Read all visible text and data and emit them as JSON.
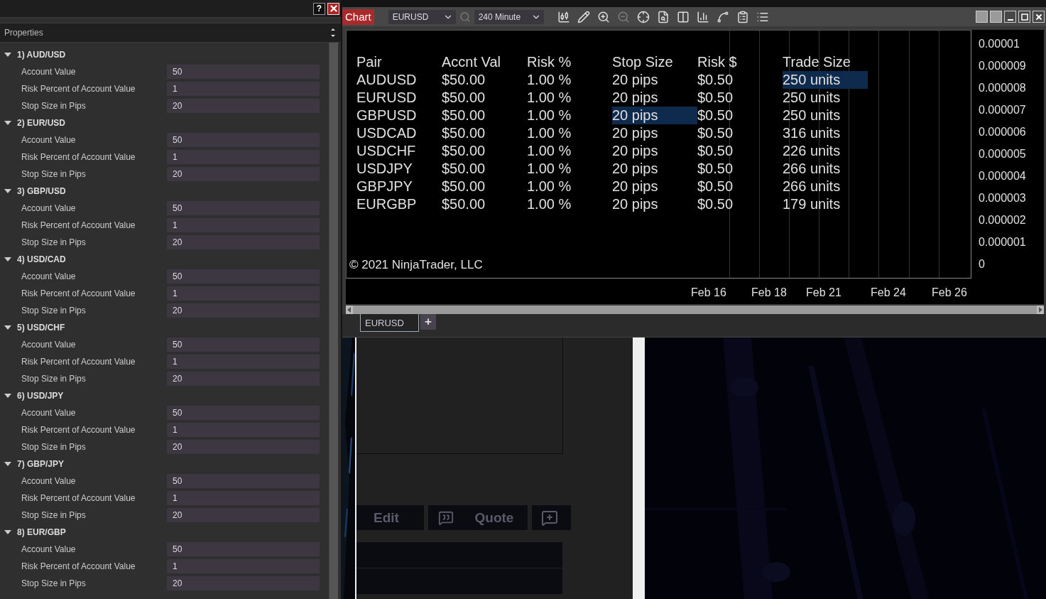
{
  "properties_window": {
    "help": "?",
    "header": "Properties",
    "groups": [
      {
        "title": "1) AUD/USD",
        "expanded": true,
        "rows": [
          {
            "label": "Account Value",
            "value": "50"
          },
          {
            "label": "Risk Percent of Account Value",
            "value": "1"
          },
          {
            "label": "Stop Size in Pips",
            "value": "20"
          }
        ]
      },
      {
        "title": "2) EUR/USD",
        "expanded": true,
        "rows": [
          {
            "label": "Account Value",
            "value": "50"
          },
          {
            "label": "Risk Percent of Account Value",
            "value": "1"
          },
          {
            "label": "Stop Size in Pips",
            "value": "20"
          }
        ]
      },
      {
        "title": "3) GBP/USD",
        "expanded": true,
        "rows": [
          {
            "label": "Account Value",
            "value": "50"
          },
          {
            "label": "Risk Percent of Account Value",
            "value": "1"
          },
          {
            "label": "Stop Size in Pips",
            "value": "20"
          }
        ]
      },
      {
        "title": "4) USD/CAD",
        "expanded": true,
        "rows": [
          {
            "label": "Account Value",
            "value": "50"
          },
          {
            "label": "Risk Percent of Account Value",
            "value": "1"
          },
          {
            "label": "Stop Size in Pips",
            "value": "20"
          }
        ]
      },
      {
        "title": "5) USD/CHF",
        "expanded": true,
        "rows": [
          {
            "label": "Account Value",
            "value": "50"
          },
          {
            "label": "Risk Percent of Account Value",
            "value": "1"
          },
          {
            "label": "Stop Size in Pips",
            "value": "20"
          }
        ]
      },
      {
        "title": "6) USD/JPY",
        "expanded": true,
        "rows": [
          {
            "label": "Account Value",
            "value": "50"
          },
          {
            "label": "Risk Percent of Account Value",
            "value": "1"
          },
          {
            "label": "Stop Size in Pips",
            "value": "20"
          }
        ]
      },
      {
        "title": "7) GBP/JPY",
        "expanded": true,
        "rows": [
          {
            "label": "Account Value",
            "value": "50"
          },
          {
            "label": "Risk Percent of Account Value",
            "value": "1"
          },
          {
            "label": "Stop Size in Pips",
            "value": "20"
          }
        ]
      },
      {
        "title": "8) EUR/GBP",
        "expanded": true,
        "rows": [
          {
            "label": "Account Value",
            "value": "50"
          },
          {
            "label": "Risk Percent of Account Value",
            "value": "1"
          },
          {
            "label": "Stop Size in Pips",
            "value": "20"
          }
        ]
      }
    ]
  },
  "chart_window": {
    "title": "Chart",
    "instrument": "EURUSD",
    "interval": "240 Minute",
    "table": {
      "columns": [
        "Pair",
        "Accnt Val",
        "Risk %",
        "Stop Size",
        "Risk $",
        "Trade Size"
      ],
      "rows": [
        {
          "cells": [
            {
              "text": "AUDUSD",
              "selected": false
            },
            {
              "text": "$50.00",
              "selected": false
            },
            {
              "text": "1.00 %",
              "selected": false
            },
            {
              "text": "20 pips",
              "selected": false
            },
            {
              "text": "$0.50",
              "selected": false
            },
            {
              "text": "250 units",
              "selected": true
            }
          ]
        },
        {
          "cells": [
            {
              "text": "EURUSD",
              "selected": false
            },
            {
              "text": "$50.00",
              "selected": false
            },
            {
              "text": "1.00 %",
              "selected": false
            },
            {
              "text": "20 pips",
              "selected": false
            },
            {
              "text": "$0.50",
              "selected": false
            },
            {
              "text": "250 units",
              "selected": false
            }
          ]
        },
        {
          "cells": [
            {
              "text": "GBPUSD",
              "selected": false
            },
            {
              "text": "$50.00",
              "selected": false
            },
            {
              "text": "1.00 %",
              "selected": false
            },
            {
              "text": "20 pips",
              "selected": true
            },
            {
              "text": "$0.50",
              "selected": false
            },
            {
              "text": "250 units",
              "selected": false
            }
          ]
        },
        {
          "cells": [
            {
              "text": "USDCAD",
              "selected": false
            },
            {
              "text": "$50.00",
              "selected": false
            },
            {
              "text": "1.00 %",
              "selected": false
            },
            {
              "text": "20 pips",
              "selected": false
            },
            {
              "text": "$0.50",
              "selected": false
            },
            {
              "text": "316 units",
              "selected": false
            }
          ]
        },
        {
          "cells": [
            {
              "text": "USDCHF",
              "selected": false
            },
            {
              "text": "$50.00",
              "selected": false
            },
            {
              "text": "1.00 %",
              "selected": false
            },
            {
              "text": "20 pips",
              "selected": false
            },
            {
              "text": "$0.50",
              "selected": false
            },
            {
              "text": "226 units",
              "selected": false
            }
          ]
        },
        {
          "cells": [
            {
              "text": "USDJPY",
              "selected": false
            },
            {
              "text": "$50.00",
              "selected": false
            },
            {
              "text": "1.00 %",
              "selected": false
            },
            {
              "text": "20 pips",
              "selected": false
            },
            {
              "text": "$0.50",
              "selected": false
            },
            {
              "text": "266 units",
              "selected": false
            }
          ]
        },
        {
          "cells": [
            {
              "text": "GBPJPY",
              "selected": false
            },
            {
              "text": "$50.00",
              "selected": false
            },
            {
              "text": "1.00 %",
              "selected": false
            },
            {
              "text": "20 pips",
              "selected": false
            },
            {
              "text": "$0.50",
              "selected": false
            },
            {
              "text": "266 units",
              "selected": false
            }
          ]
        },
        {
          "cells": [
            {
              "text": "EURGBP",
              "selected": false
            },
            {
              "text": "$50.00",
              "selected": false
            },
            {
              "text": "1.00 %",
              "selected": false
            },
            {
              "text": "20 pips",
              "selected": false
            },
            {
              "text": "$0.50",
              "selected": false
            },
            {
              "text": "179 units",
              "selected": false
            }
          ]
        }
      ]
    },
    "copyright": "© 2021 NinjaTrader, LLC",
    "y_axis": [
      "0.00001",
      "0.000009",
      "0.000008",
      "0.000007",
      "0.000006",
      "0.000005",
      "0.000004",
      "0.000003",
      "0.000002",
      "0.000001",
      "0"
    ],
    "x_axis": [
      "Feb 16",
      "Feb 18",
      "Feb 21",
      "Feb 24",
      "Feb 26"
    ],
    "tabs": [
      {
        "label": "EURUSD",
        "selected": true
      }
    ],
    "add_tab": "+"
  },
  "background_page": {
    "buttons": [
      {
        "kind": "text",
        "label": "Edit"
      },
      {
        "kind": "icon-text",
        "label": "Quote"
      },
      {
        "kind": "icon"
      }
    ]
  }
}
